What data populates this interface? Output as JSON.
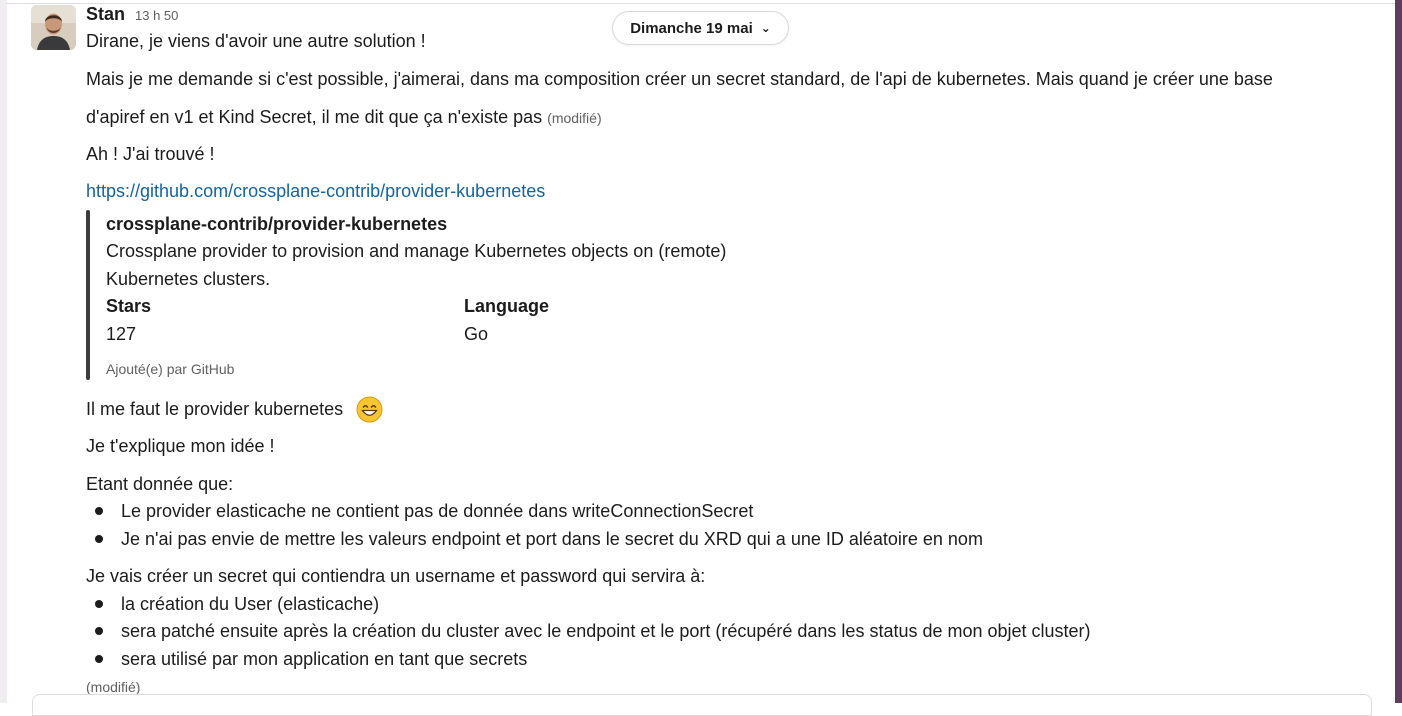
{
  "message": {
    "author": "Stan",
    "time": "13 h 50",
    "date_pill": "Dimanche 19 mai",
    "lines": {
      "l1": "Dirane, je viens d'avoir une autre solution !",
      "l2a": "Mais je me demande si c'est possible, j'aimerai, dans ma composition créer un secret standard, de l'api de kubernetes. Mais quand je créer une base",
      "l2b": "d'apiref en v1 et Kind Secret, il me dit que ça n'existe pas",
      "edited": "(modifié)",
      "l3": "Ah ! J'ai trouvé !",
      "link": "https://github.com/crossplane-contrib/provider-kubernetes",
      "l4": "Il me faut le provider kubernetes",
      "l5": "Je t'explique mon idée !",
      "l6": "Etant donnée que:",
      "l7": "Je vais créer un secret qui contiendra un username et password qui servira à:",
      "final_edited": "(modifié)"
    },
    "bullets_1": [
      "Le provider elasticache ne contient pas de donnée dans writeConnectionSecret",
      "Je n'ai pas envie de mettre les valeurs endpoint et port dans le secret du XRD qui a une ID aléatoire en nom"
    ],
    "bullets_2": [
      "la création du User (elasticache)",
      "sera patché ensuite après la création du cluster avec le endpoint et le port (récupéré dans les status de mon objet cluster)",
      "sera utilisé par mon application en tant que secrets"
    ],
    "unfurl": {
      "title": "crossplane-contrib/provider-kubernetes",
      "desc_1": "Crossplane provider to provision and manage Kubernetes objects on (remote)",
      "desc_2": "Kubernetes clusters.",
      "stars_label": "Stars",
      "stars_value": "127",
      "language_label": "Language",
      "language_value": "Go",
      "footer": "Ajouté(e) par GitHub"
    },
    "emoji_icon": "grinning-face-emoji"
  }
}
